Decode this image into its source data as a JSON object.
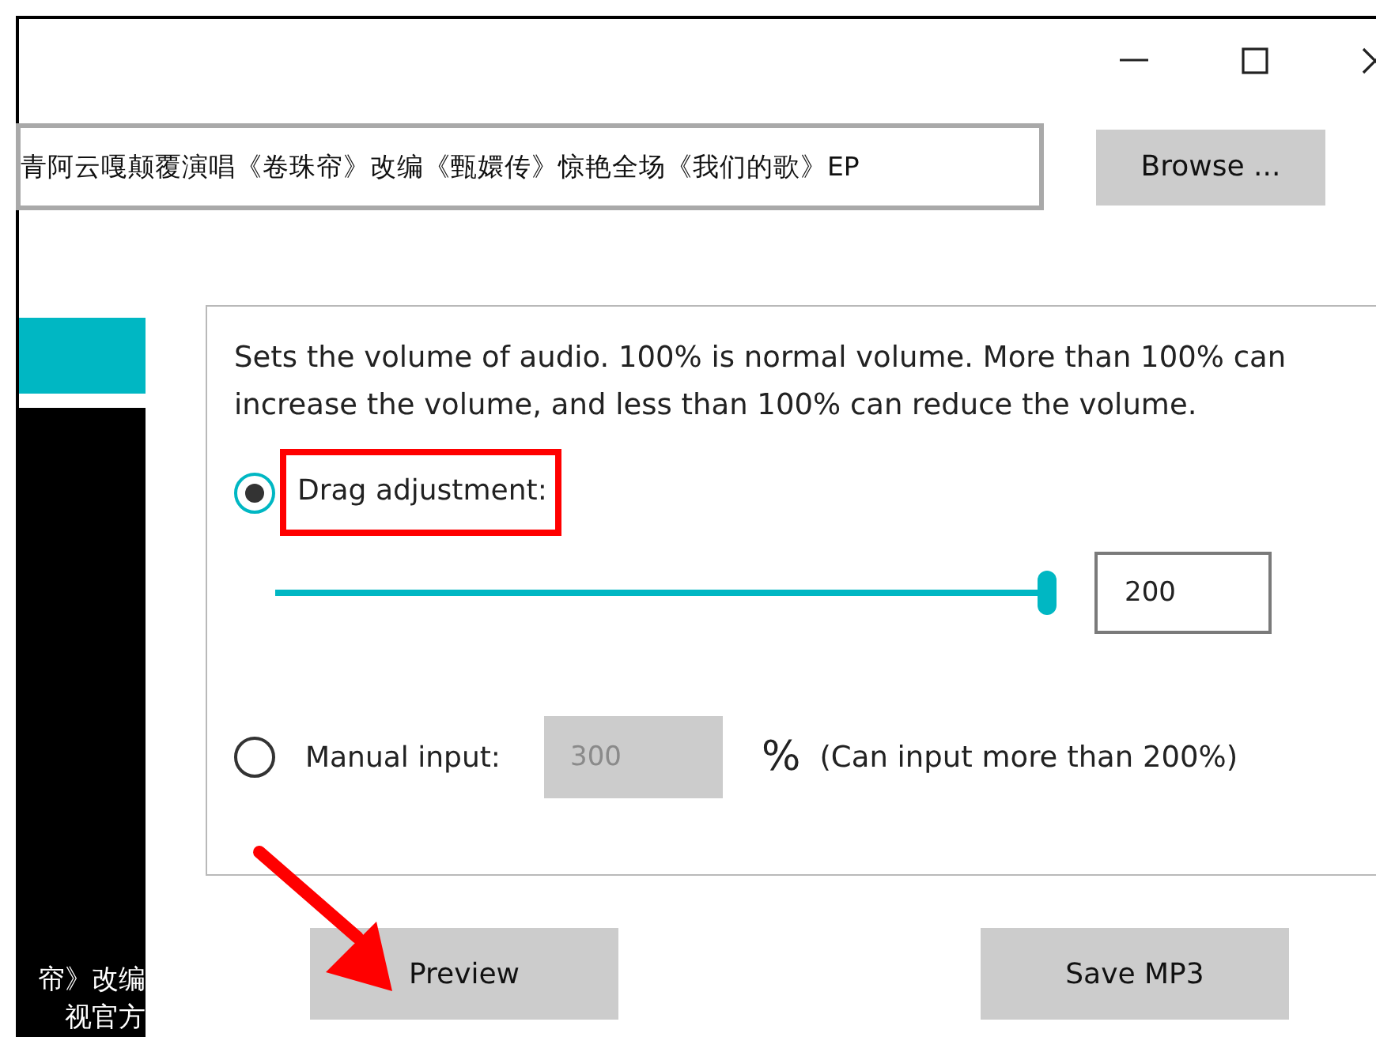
{
  "window": {
    "controls": [
      {
        "kind": "minimize"
      },
      {
        "kind": "maximize"
      },
      {
        "kind": "close"
      }
    ]
  },
  "file": {
    "value": "青阿云嘎颠覆演唱《卷珠帘》改编《甄嬛传》惊艳全场《我们的歌》EP",
    "browse": "Browse ..."
  },
  "sidebar": {
    "lines": [
      "帘》改编",
      "视官方"
    ]
  },
  "volume": {
    "description": "Sets the volume of audio. 100% is normal volume. More than 100% can increase the volume, and less than 100% can reduce the volume.",
    "options": [
      {
        "label": "Drag adjustment:",
        "selected": true,
        "kind": "slider",
        "level": 1,
        "value": "200",
        "highlighted": true
      },
      {
        "label": "Manual input:",
        "selected": false,
        "kind": "input",
        "value": "300",
        "disabled": true,
        "unit": "%",
        "note": "(Can input more than 200%)"
      }
    ]
  },
  "buttons": [
    {
      "label": "Preview",
      "pointed": true
    },
    {
      "label": "Save MP3",
      "pointed": false
    }
  ]
}
